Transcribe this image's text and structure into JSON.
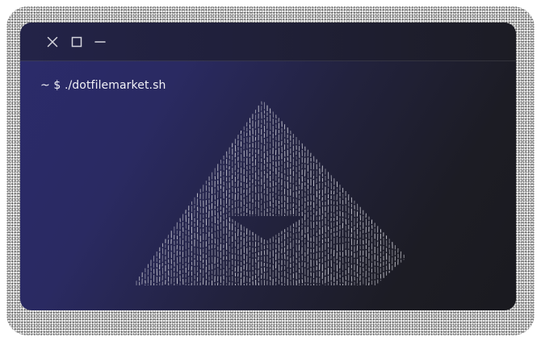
{
  "window": {
    "controls": {
      "close_icon": "close-icon",
      "maximize_icon": "maximize-icon",
      "minimize_icon": "minimize-icon"
    },
    "prompt": "~ $ ./dotfilemarket.sh"
  },
  "ascii_art": {
    "subject": "triangle-logo",
    "color": "#d8d8e0"
  },
  "colors": {
    "gradient_start": "#2b2b6b",
    "gradient_end": "#1a1a1f",
    "text": "#f2f2f7"
  }
}
